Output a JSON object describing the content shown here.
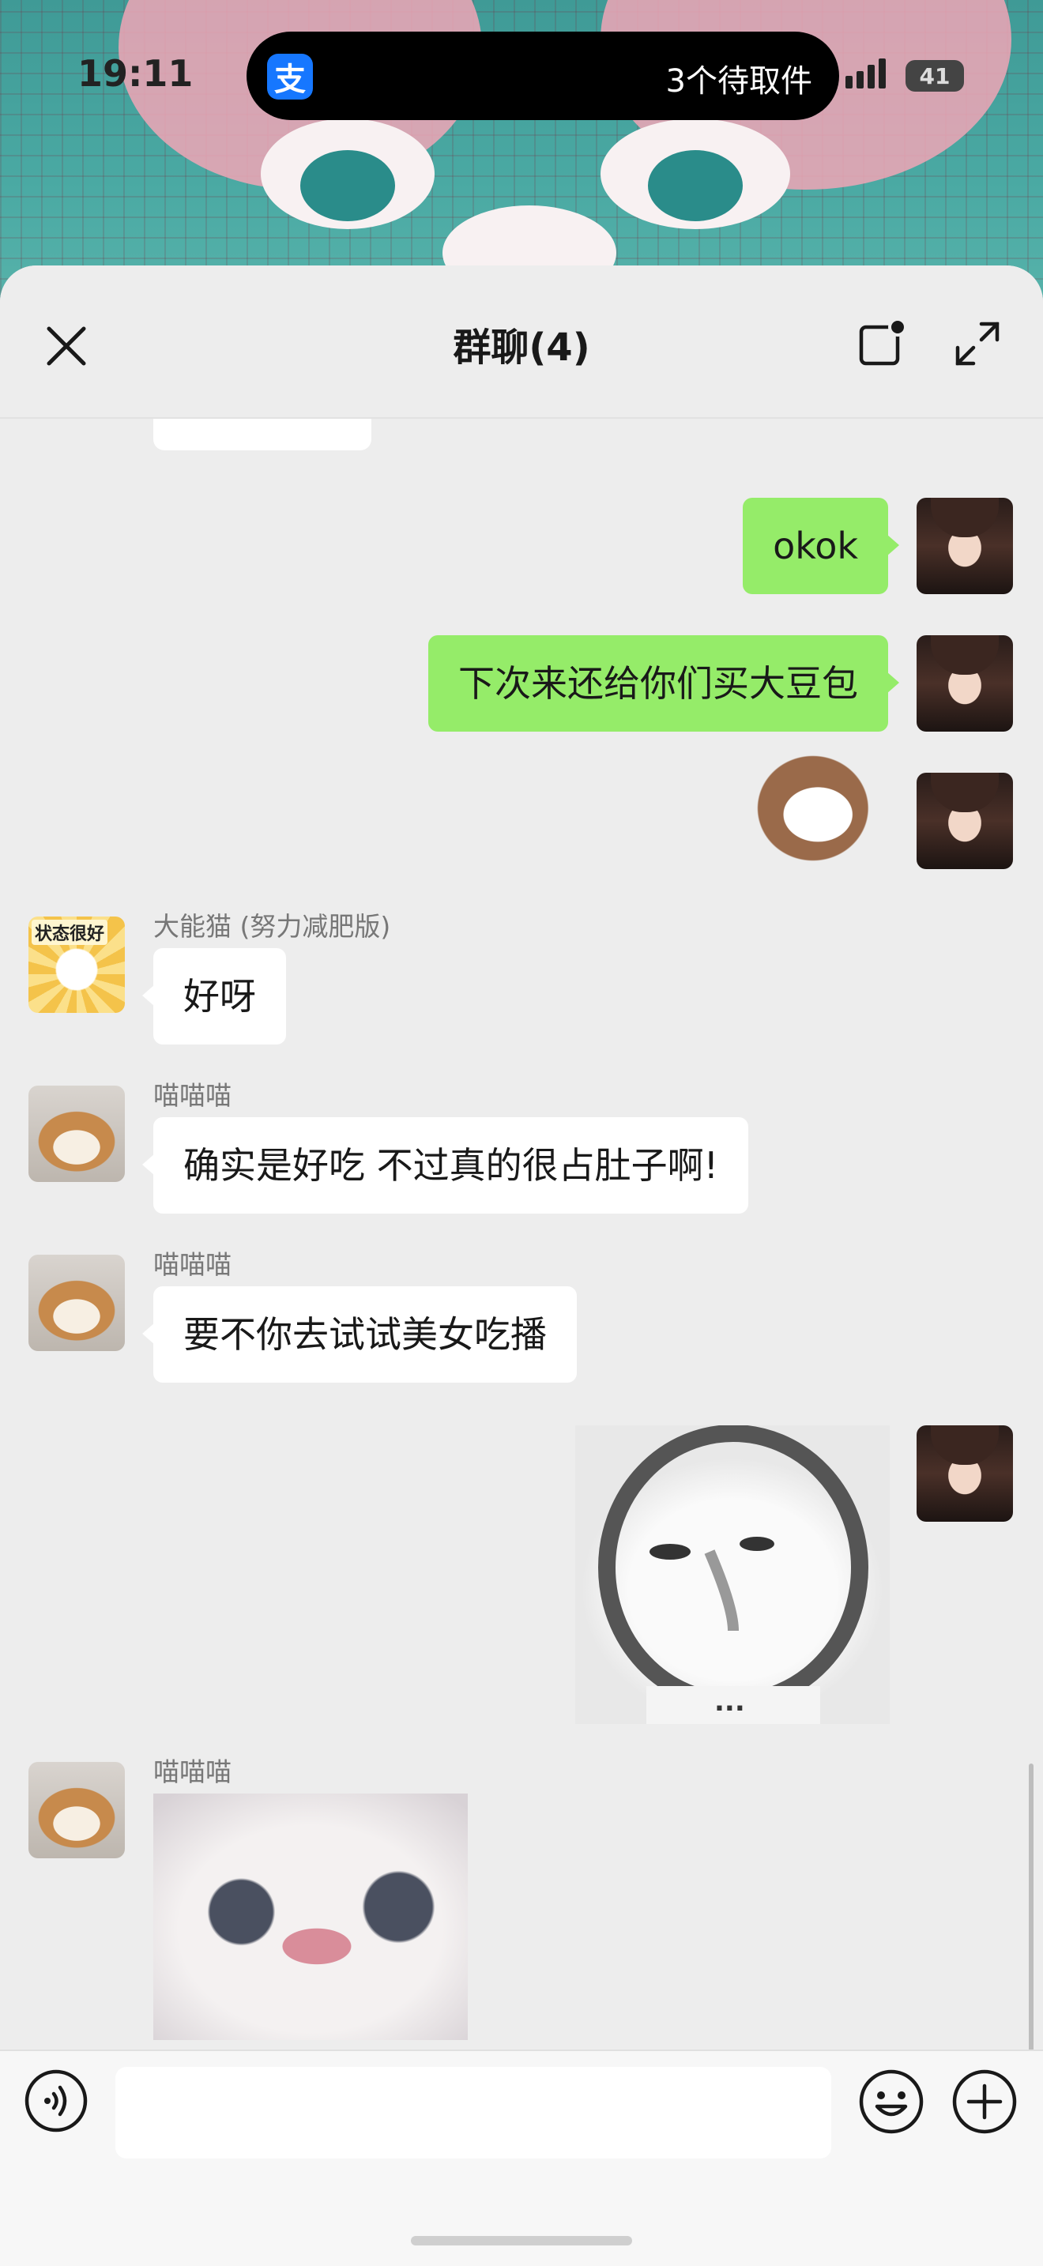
{
  "status_bar": {
    "time": "19:11",
    "island_app_icon": "alipay-icon",
    "island_app_glyph": "支",
    "island_text": "3个待取件",
    "battery": "41"
  },
  "header": {
    "title": "群聊(4)",
    "close_icon": "close-icon",
    "float_icon": "floating-window-icon",
    "expand_icon": "expand-icon"
  },
  "messages": [
    {
      "from": "me",
      "type": "text",
      "text": "okok"
    },
    {
      "from": "me",
      "type": "text",
      "text": "下次来还给你们买大豆包"
    },
    {
      "from": "me",
      "type": "sticker",
      "sticker": "cat-sticker"
    },
    {
      "from": "other",
      "sender": "大能猫 (努力减肥版)",
      "avatar_tag": "状态很好",
      "type": "text",
      "text": "好呀"
    },
    {
      "from": "other",
      "sender": "喵喵喵",
      "type": "text",
      "text": "确实是好吃  不过真的很占肚子啊!"
    },
    {
      "from": "other",
      "sender": "喵喵喵",
      "type": "text",
      "text": "要不你去试试美女吃播"
    },
    {
      "from": "me",
      "type": "sticker",
      "sticker": "meme-face-sticker",
      "caption": "..."
    },
    {
      "from": "other",
      "sender": "喵喵喵",
      "type": "sticker",
      "sticker": "kitten-face-sticker"
    }
  ],
  "input_bar": {
    "voice_icon": "voice-icon",
    "input_value": "",
    "emoji_icon": "emoji-icon",
    "plus_icon": "plus-icon"
  },
  "colors": {
    "my_bubble": "#95ec69",
    "other_bubble": "#ffffff",
    "chat_background": "#ededed",
    "alipay_blue": "#1677ff"
  }
}
